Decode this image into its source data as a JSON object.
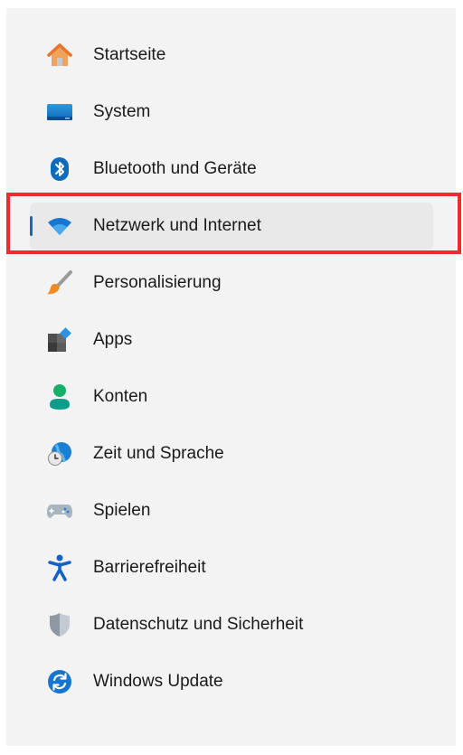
{
  "nav": {
    "items": [
      {
        "label": "Startseite",
        "icon": "home-icon"
      },
      {
        "label": "System",
        "icon": "monitor-icon"
      },
      {
        "label": "Bluetooth und Geräte",
        "icon": "bluetooth-icon"
      },
      {
        "label": "Netzwerk und Internet",
        "icon": "wifi-icon",
        "selected": true
      },
      {
        "label": "Personalisierung",
        "icon": "brush-icon"
      },
      {
        "label": "Apps",
        "icon": "apps-icon"
      },
      {
        "label": "Konten",
        "icon": "person-icon"
      },
      {
        "label": "Zeit und Sprache",
        "icon": "globe-clock-icon"
      },
      {
        "label": "Spielen",
        "icon": "gamepad-icon"
      },
      {
        "label": "Barrierefreiheit",
        "icon": "accessibility-icon"
      },
      {
        "label": "Datenschutz und Sicherheit",
        "icon": "shield-icon"
      },
      {
        "label": "Windows Update",
        "icon": "update-icon"
      }
    ]
  },
  "colors": {
    "accent": "#0f6cbd",
    "highlight_border": "#ee2b2e",
    "panel_background": "#f3f3f3",
    "selected_background": "#e9e9e9"
  }
}
